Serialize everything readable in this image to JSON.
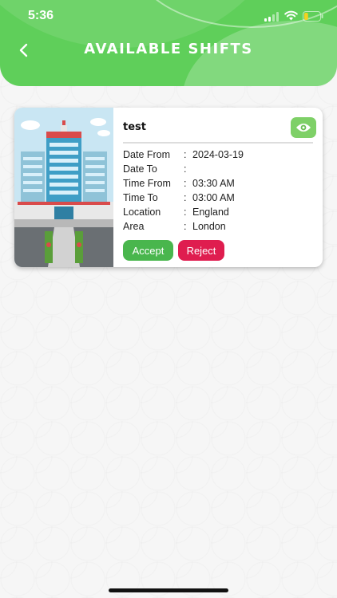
{
  "status_bar": {
    "time": "5:36",
    "signal_icon": "cellular-signal-icon",
    "wifi_icon": "wifi-icon",
    "battery_icon": "battery-icon",
    "battery_level": 0.25
  },
  "header": {
    "title": "AVAILABLE SHIFTS",
    "back_icon": "chevron-left-icon",
    "color": "#5fcf5a"
  },
  "shift_card": {
    "image": "hospital-building-illustration",
    "title": "test",
    "view_icon": "eye-icon",
    "fields": [
      {
        "label": "Date From",
        "value": "2024-03-19"
      },
      {
        "label": "Date To",
        "value": ""
      },
      {
        "label": "Time From",
        "value": "03:30 AM"
      },
      {
        "label": "Time To",
        "value": "03:00 AM"
      },
      {
        "label": "Location",
        "value": "England"
      },
      {
        "label": "Area",
        "value": "London"
      }
    ],
    "separator": ":",
    "accept_label": "Accept",
    "reject_label": "Reject",
    "accept_color": "#49b64d",
    "reject_color": "#df1d4f"
  }
}
